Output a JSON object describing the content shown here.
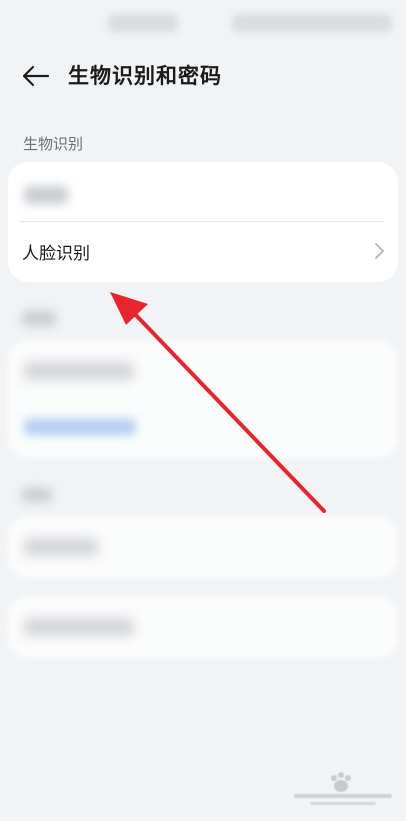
{
  "header": {
    "title": "生物识别和密码"
  },
  "sections": {
    "biometrics": {
      "label": "生物识别",
      "items": [
        {
          "label": ""
        },
        {
          "label": "人脸识别"
        }
      ]
    }
  },
  "icons": {
    "back": "back-arrow-icon",
    "chevron": "chevron-right-icon"
  },
  "colors": {
    "background": "#f1f3f5",
    "card": "#ffffff",
    "annotation_arrow": "#e8252e"
  }
}
